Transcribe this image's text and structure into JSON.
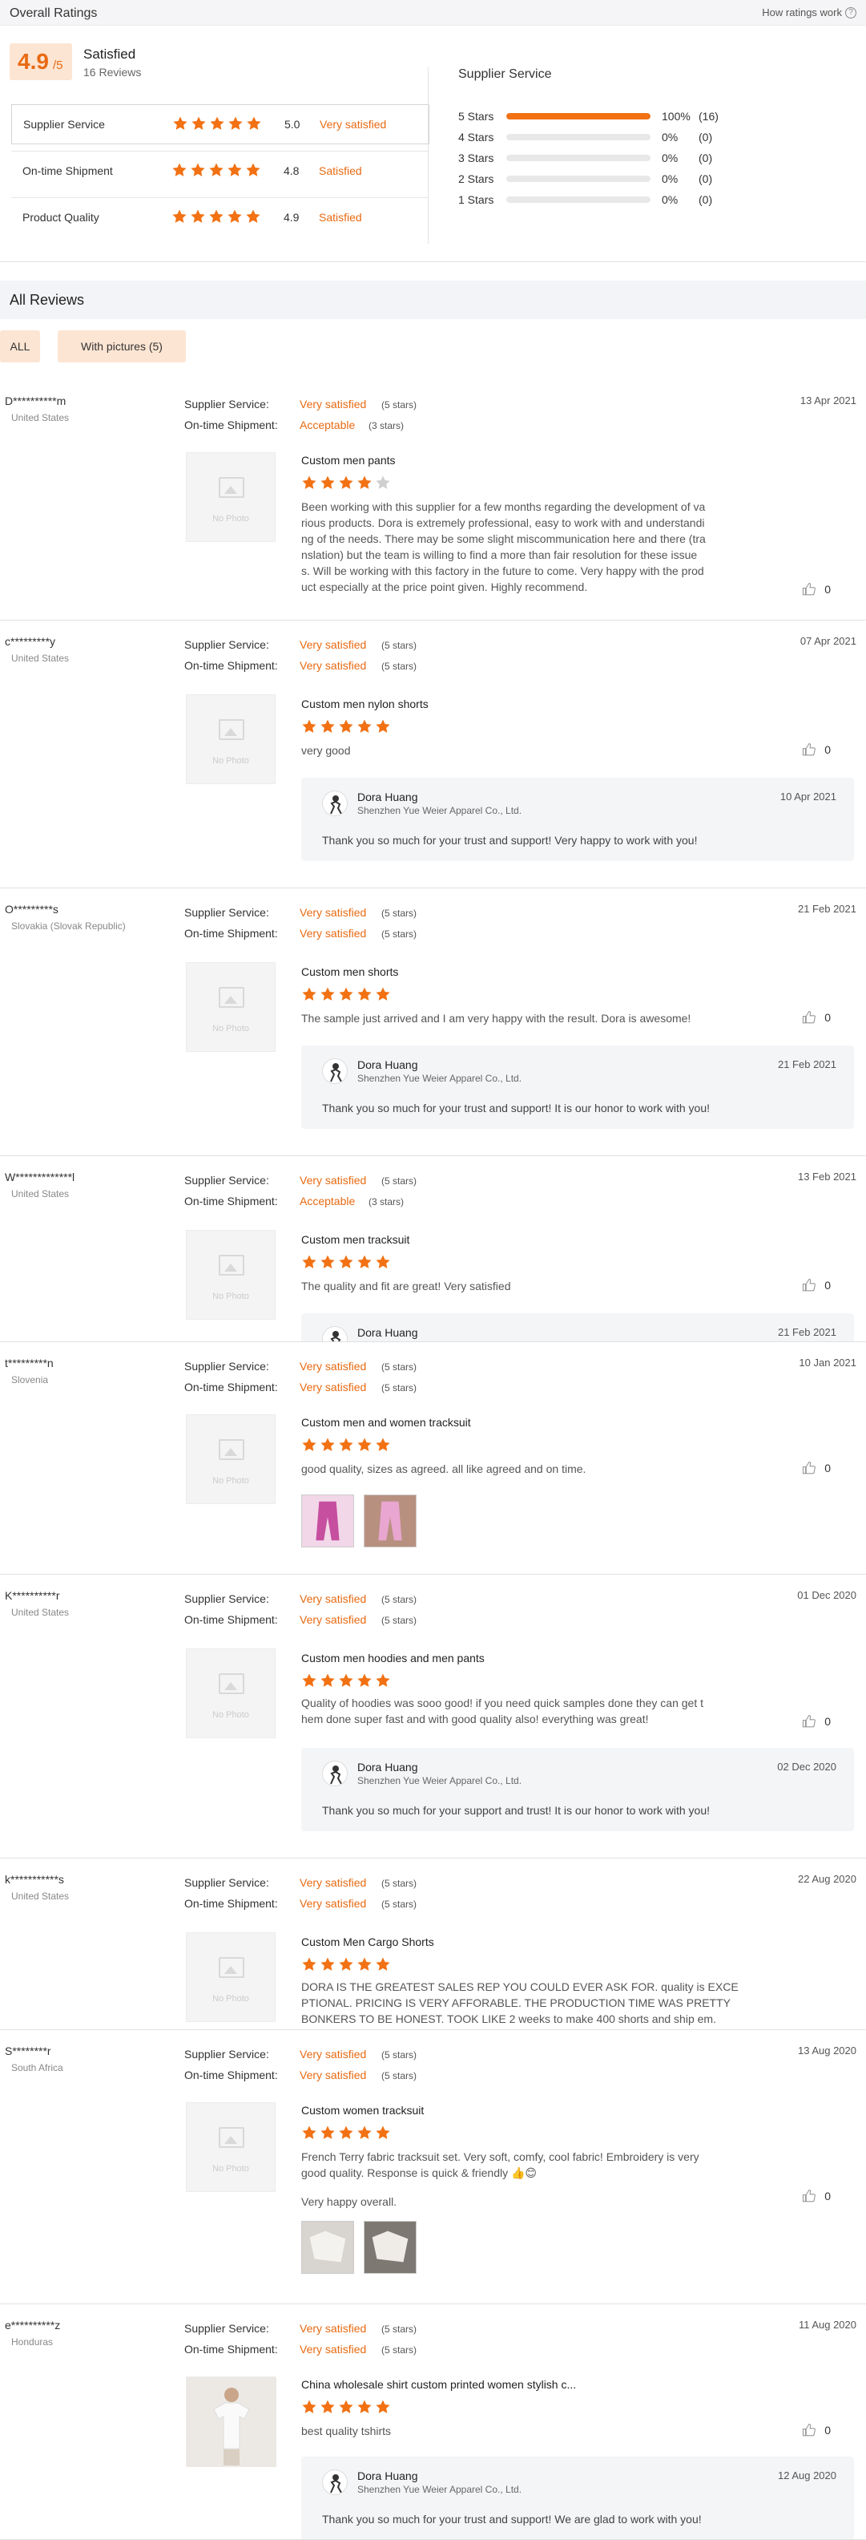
{
  "header": {
    "title": "Overall Ratings",
    "how_link": "How ratings work",
    "help_glyph": "?"
  },
  "overall": {
    "score": "4.9",
    "out_of": "/5",
    "label": "Satisfied",
    "count": "16 Reviews"
  },
  "metrics": [
    {
      "label": "Supplier Service",
      "score": "5.0",
      "text": "Very satisfied",
      "stars": 5
    },
    {
      "label": "On-time Shipment",
      "score": "4.8",
      "text": "Satisfied",
      "stars": 5
    },
    {
      "label": "Product Quality",
      "score": "4.9",
      "text": "Satisfied",
      "stars": 5
    }
  ],
  "distribution": {
    "title": "Supplier Service",
    "rows": [
      {
        "label": "5 Stars",
        "fraction": 1.0,
        "percent": "100%",
        "count": "(16)"
      },
      {
        "label": "4 Stars",
        "fraction": 0,
        "percent": "0%",
        "count": "(0)"
      },
      {
        "label": "3 Stars",
        "fraction": 0,
        "percent": "0%",
        "count": "(0)"
      },
      {
        "label": "2 Stars",
        "fraction": 0,
        "percent": "0%",
        "count": "(0)"
      },
      {
        "label": "1 Stars",
        "fraction": 0,
        "percent": "0%",
        "count": "(0)"
      }
    ]
  },
  "all_reviews": {
    "title": "All Reviews",
    "filters": [
      "ALL",
      "With pictures (5)"
    ]
  },
  "labels": {
    "supplier_service": "Supplier Service:",
    "ontime": "On-time Shipment:",
    "no_photo": "No Photo"
  },
  "colors": {
    "accent": "#e86a12",
    "star_fill": "#f27113",
    "star_empty": "#cfcfcf",
    "tint": "#fde5d3"
  },
  "reviews": [
    {
      "name": "D**********m",
      "country": "United States",
      "date": "13 Apr 2021",
      "ss_value": "Very satisfied",
      "ss_stars": "(5 stars)",
      "os_value": "Acceptable",
      "os_stars": "(3 stars)",
      "product": "Custom men pants",
      "rating": 4,
      "text_lines": [
        "Been working with this supplier for a few months regarding the development of va",
        "rious products. Dora is extremely professional, easy to work with and understandi",
        "ng of the needs. There may be some slight miscommunication here and there (tra",
        "nslation) but the team is willing to find a more than fair resolution for these issue",
        "s. Will be working with this factory in the future to come. Very happy with the prod",
        "uct especially at the price point given. Highly recommend."
      ],
      "likes": "0"
    },
    {
      "name": "c*********y",
      "country": "United States",
      "date": "07 Apr 2021",
      "ss_value": "Very satisfied",
      "ss_stars": "(5 stars)",
      "os_value": "Very satisfied",
      "os_stars": "(5 stars)",
      "product": "Custom men nylon shorts",
      "rating": 5,
      "text_lines": [
        "very good"
      ],
      "likes": "0",
      "reply": {
        "name": "Dora Huang",
        "company": "Shenzhen Yue Weier Apparel Co., Ltd.",
        "date": "10 Apr 2021",
        "text": "Thank you so much for your trust and support! Very happy to work with you!"
      }
    },
    {
      "name": "O*********s",
      "country": "Slovakia (Slovak Republic)",
      "date": "21 Feb 2021",
      "ss_value": "Very satisfied",
      "ss_stars": "(5 stars)",
      "os_value": "Very satisfied",
      "os_stars": "(5 stars)",
      "product": "Custom men shorts",
      "rating": 5,
      "text_lines": [
        "The sample just arrived and I am very happy with the result. Dora is awesome!"
      ],
      "likes": "0",
      "reply": {
        "name": "Dora Huang",
        "company": "Shenzhen Yue Weier Apparel Co., Ltd.",
        "date": "21 Feb 2021",
        "text": "Thank you so much for your trust and support! It is our honor to work with you!"
      }
    },
    {
      "name": "W*************l",
      "country": "United States",
      "date": "13 Feb 2021",
      "ss_value": "Very satisfied",
      "ss_stars": "(5 stars)",
      "os_value": "Acceptable",
      "os_stars": "(3 stars)",
      "product": "Custom men tracksuit",
      "rating": 5,
      "text_lines": [
        "The quality and fit are great! Very satisfied"
      ],
      "likes": "0",
      "reply": {
        "name": "Dora Huang",
        "company": "",
        "date": "21 Feb 2021",
        "text": ""
      }
    },
    {
      "name": "t*********n",
      "country": "Slovenia",
      "date": "10 Jan 2021",
      "ss_value": "Very satisfied",
      "ss_stars": "(5 stars)",
      "os_value": "Very satisfied",
      "os_stars": "(5 stars)",
      "product": "Custom men and women tracksuit",
      "rating": 5,
      "text_lines": [
        "good quality, sizes as agreed. all like agreed and on time."
      ],
      "likes": "0",
      "photos": 2
    },
    {
      "name": "K**********r",
      "country": "United States",
      "date": "01 Dec 2020",
      "ss_value": "Very satisfied",
      "ss_stars": "(5 stars)",
      "os_value": "Very satisfied",
      "os_stars": "(5 stars)",
      "product": "Custom men hoodies and men pants",
      "rating": 5,
      "text_lines": [
        "Quality of hoodies was sooo good! if you need quick samples done they can get t",
        "hem done super fast and with good quality also! everything was great!"
      ],
      "likes": "0",
      "reply": {
        "name": "Dora Huang",
        "company": "Shenzhen Yue Weier Apparel Co., Ltd.",
        "date": "02 Dec 2020",
        "text": "Thank you so much for your support and trust! It is our honor to work with you!"
      }
    },
    {
      "name": "k***********s",
      "country": "United States",
      "date": "22 Aug 2020",
      "ss_value": "Very satisfied",
      "ss_stars": "(5 stars)",
      "os_value": "Very satisfied",
      "os_stars": "(5 stars)",
      "product": "Custom Men Cargo Shorts",
      "rating": 5,
      "text_lines": [
        "DORA IS THE GREATEST SALES REP YOU COULD EVER ASK FOR. quality is EXCE",
        "PTIONAL. PRICING IS VERY AFFORABLE. THE PRODUCTION TIME WAS PRETTY",
        "BONKERS TO BE HONEST. TOOK LIKE 2 weeks to make 400 shorts and ship em."
      ],
      "likes": ""
    },
    {
      "name": "S********r",
      "country": "South Africa",
      "date": "13 Aug 2020",
      "ss_value": "Very satisfied",
      "ss_stars": "(5 stars)",
      "os_value": "Very satisfied",
      "os_stars": "(5 stars)",
      "product": "Custom women tracksuit",
      "rating": 5,
      "text_lines": [
        "French Terry fabric tracksuit set. Very soft, comfy, cool fabric! Embroidery is very",
        "good quality. Response is quick & friendly 👍😊",
        "",
        "Very happy overall."
      ],
      "likes": "0",
      "photos": 2
    },
    {
      "name": "e**********z",
      "country": "Honduras",
      "date": "11 Aug 2020",
      "ss_value": "Very satisfied",
      "ss_stars": "(5 stars)",
      "os_value": "Very satisfied",
      "os_stars": "(5 stars)",
      "product": "China wholesale shirt custom printed women stylish c...",
      "rating": 5,
      "text_lines": [
        "best quality tshirts"
      ],
      "likes": "0",
      "reply": {
        "name": "Dora Huang",
        "company": "Shenzhen Yue Weier Apparel Co., Ltd.",
        "date": "12 Aug 2020",
        "text": "Thank you so much for your trust and support! We are glad to work with you!"
      }
    }
  ]
}
